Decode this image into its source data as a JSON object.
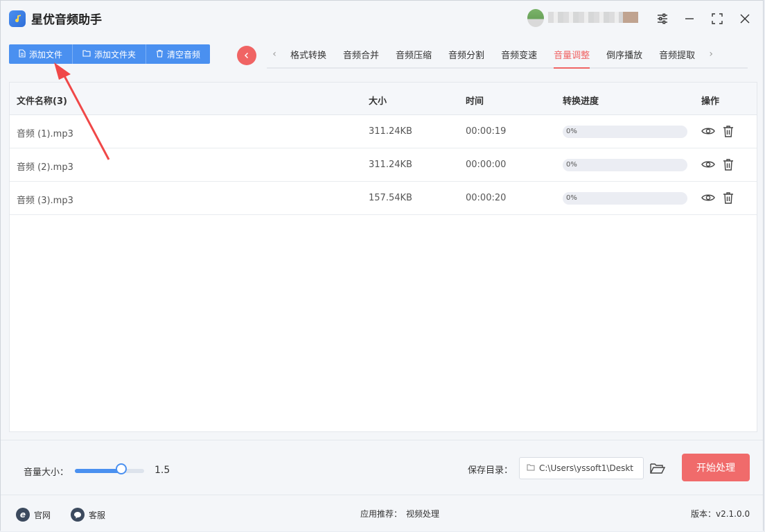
{
  "app": {
    "title": "星优音频助手"
  },
  "toolbar": {
    "add_file": "添加文件",
    "add_folder": "添加文件夹",
    "clear_audio": "清空音频"
  },
  "tabs": [
    {
      "label": "格式转换",
      "active": false
    },
    {
      "label": "音频合并",
      "active": false
    },
    {
      "label": "音频压缩",
      "active": false
    },
    {
      "label": "音频分割",
      "active": false
    },
    {
      "label": "音频变速",
      "active": false
    },
    {
      "label": "音量调整",
      "active": true
    },
    {
      "label": "倒序播放",
      "active": false
    },
    {
      "label": "音频提取",
      "active": false
    }
  ],
  "table": {
    "headers": {
      "name": "文件名称(3)",
      "size": "大小",
      "time": "时间",
      "progress": "转换进度",
      "actions": "操作"
    },
    "rows": [
      {
        "name": "音频 (1).mp3",
        "size": "311.24KB",
        "time": "00:00:19",
        "progress": "0%"
      },
      {
        "name": "音频 (2).mp3",
        "size": "311.24KB",
        "time": "00:00:00",
        "progress": "0%"
      },
      {
        "name": "音频 (3).mp3",
        "size": "157.54KB",
        "time": "00:00:20",
        "progress": "0%"
      }
    ]
  },
  "volume": {
    "label": "音量大小：",
    "value": "1.5",
    "level": 0.67
  },
  "save": {
    "label": "保存目录：",
    "path": "C:\\Users\\yssoft1\\Deskt"
  },
  "start_button": "开始处理",
  "footer": {
    "website": "官网",
    "service": "客服",
    "recommend_label": "应用推荐：",
    "recommend_item": "视频处理",
    "version": "版本：v2.1.0.0"
  },
  "colors": {
    "accent_blue": "#4a90f0",
    "accent_red": "#f06464"
  }
}
